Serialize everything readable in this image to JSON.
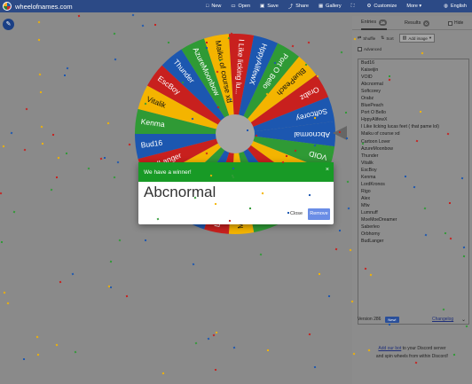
{
  "header": {
    "site_name": "wheelofnames.com",
    "nav": [
      {
        "icon": "new-icon",
        "glyph": "□",
        "label": "New"
      },
      {
        "icon": "open-icon",
        "glyph": "▭",
        "label": "Open"
      },
      {
        "icon": "save-icon",
        "glyph": "▣",
        "label": "Save"
      },
      {
        "icon": "share-icon",
        "glyph": "⤴",
        "label": "Share"
      },
      {
        "icon": "gallery-icon",
        "glyph": "▦",
        "label": "Gallery"
      },
      {
        "icon": "fullscreen-icon",
        "glyph": "⛶",
        "label": ""
      },
      {
        "icon": "customize-icon",
        "glyph": "⚙",
        "label": "Customize"
      },
      {
        "icon": "more-icon",
        "glyph": "",
        "label": "More ▾"
      }
    ],
    "language": "English"
  },
  "wheel": {
    "colors": [
      "#1c57b0",
      "#2f9a35",
      "#f4b400",
      "#c8201e"
    ],
    "labels": [
      "Abcnormal",
      "VOID",
      "Kenmo",
      "Lordkronos",
      "Rigo",
      "Alex",
      "Mfw",
      "Lumnuff",
      "MoeMoeDreamer",
      "Saberleo",
      "Orbhomy",
      "BudLanger",
      "Bud16",
      "Kenma",
      "Vitalik",
      "EscBoy",
      "Thunder",
      "AzureMoonbow",
      "Maiku of course xd",
      "I Like licking lu...",
      "HppyAlifewX",
      "Port O Bello",
      "BluePeach",
      "Orabz",
      "Softcorey"
    ]
  },
  "modal": {
    "title": "We have a winner!",
    "close_x": "×",
    "winner": "Abcnormal",
    "close_label": "Close",
    "remove_label": "Remove"
  },
  "sidebar": {
    "tab_entries": "Entries",
    "entries_count": "28",
    "tab_results": "Results",
    "results_count": "0",
    "hide_label": "Hide",
    "shuffle_label": "Shuffle",
    "sort_label": "Sort",
    "add_image_label": "Add image",
    "advanced_label": "Advanced",
    "entries": [
      "Bud16",
      "Kaiseijin",
      "VOID",
      "Abcnormal",
      "Softcorey",
      "Orabz",
      "BluePeach",
      "Port O Bello",
      "HppyAlifewX",
      "I Like licking lucas feet ( that pame lol)",
      "Maiku of course xd",
      "Cartoon Lover",
      "AzureMoonbow",
      "Thunder",
      "Vitalik",
      "EscBoy",
      "Kenma",
      "LordKronos",
      "Rigo",
      "Alex",
      "Mfw",
      "Lumnuff",
      "MoeMoeDreamer",
      "Saberleo",
      "Orbhomy",
      "BudLanger"
    ],
    "version": "Version 286",
    "new_badge": "New!",
    "changelog": "Changelog",
    "discord_link": "Add our bot",
    "discord_text1": " to your Discord server",
    "discord_text2": "and spin wheels from within Discord!"
  }
}
